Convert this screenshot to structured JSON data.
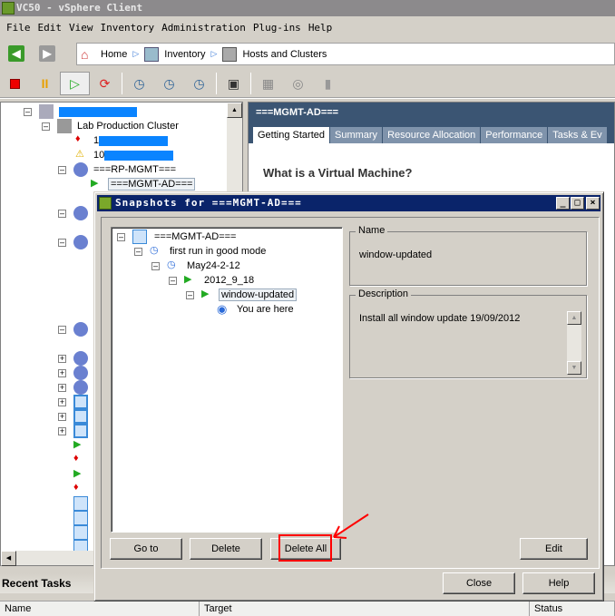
{
  "window": {
    "title": "VC50 - vSphere Client"
  },
  "menu": [
    "File",
    "Edit",
    "View",
    "Inventory",
    "Administration",
    "Plug-ins",
    "Help"
  ],
  "breadcrumb": [
    {
      "label": "Home",
      "icon": "home-icon"
    },
    {
      "label": "Inventory",
      "icon": "inventory-icon"
    },
    {
      "label": "Hosts and Clusters",
      "icon": "hosts-clusters-icon"
    }
  ],
  "toolbar": [
    "power-off-icon",
    "suspend-icon",
    "power-on-icon",
    "reset-icon",
    "take-snapshot-icon",
    "revert-snapshot-icon",
    "snapshot-manager-icon",
    "console-icon",
    "floppy-icon",
    "cd-dvd-icon",
    "usb-icon"
  ],
  "tree": {
    "cluster": "Lab Production Cluster",
    "host1_prefix": "1",
    "host2_prefix": "10",
    "resource_pool": "===RP-MGMT===",
    "selected_vm": "===MGMT-AD==="
  },
  "right_panel": {
    "title": "===MGMT-AD===",
    "tabs": [
      "Getting Started",
      "Summary",
      "Resource Allocation",
      "Performance",
      "Tasks & Ev"
    ],
    "heading": "What is a Virtual Machine?"
  },
  "recent_tasks": {
    "title": "Recent Tasks",
    "columns": [
      "Name",
      "Target",
      "Status"
    ]
  },
  "dialog": {
    "title": "Snapshots for ===MGMT-AD===",
    "snapshot_tree": {
      "root": "===MGMT-AD===",
      "nodes": [
        "first run in good mode",
        "May24-2-12",
        "2012_9_18",
        "window-updated"
      ],
      "current": "You are here"
    },
    "name_label": "Name",
    "name_value": "window-updated",
    "description_label": "Description",
    "description_value": "Install all window update 19/09/2012",
    "buttons": {
      "goto": "Go to",
      "delete": "Delete",
      "delete_all": "Delete All",
      "edit": "Edit",
      "close": "Close",
      "help": "Help"
    },
    "highlight_color": "#ff0000"
  }
}
